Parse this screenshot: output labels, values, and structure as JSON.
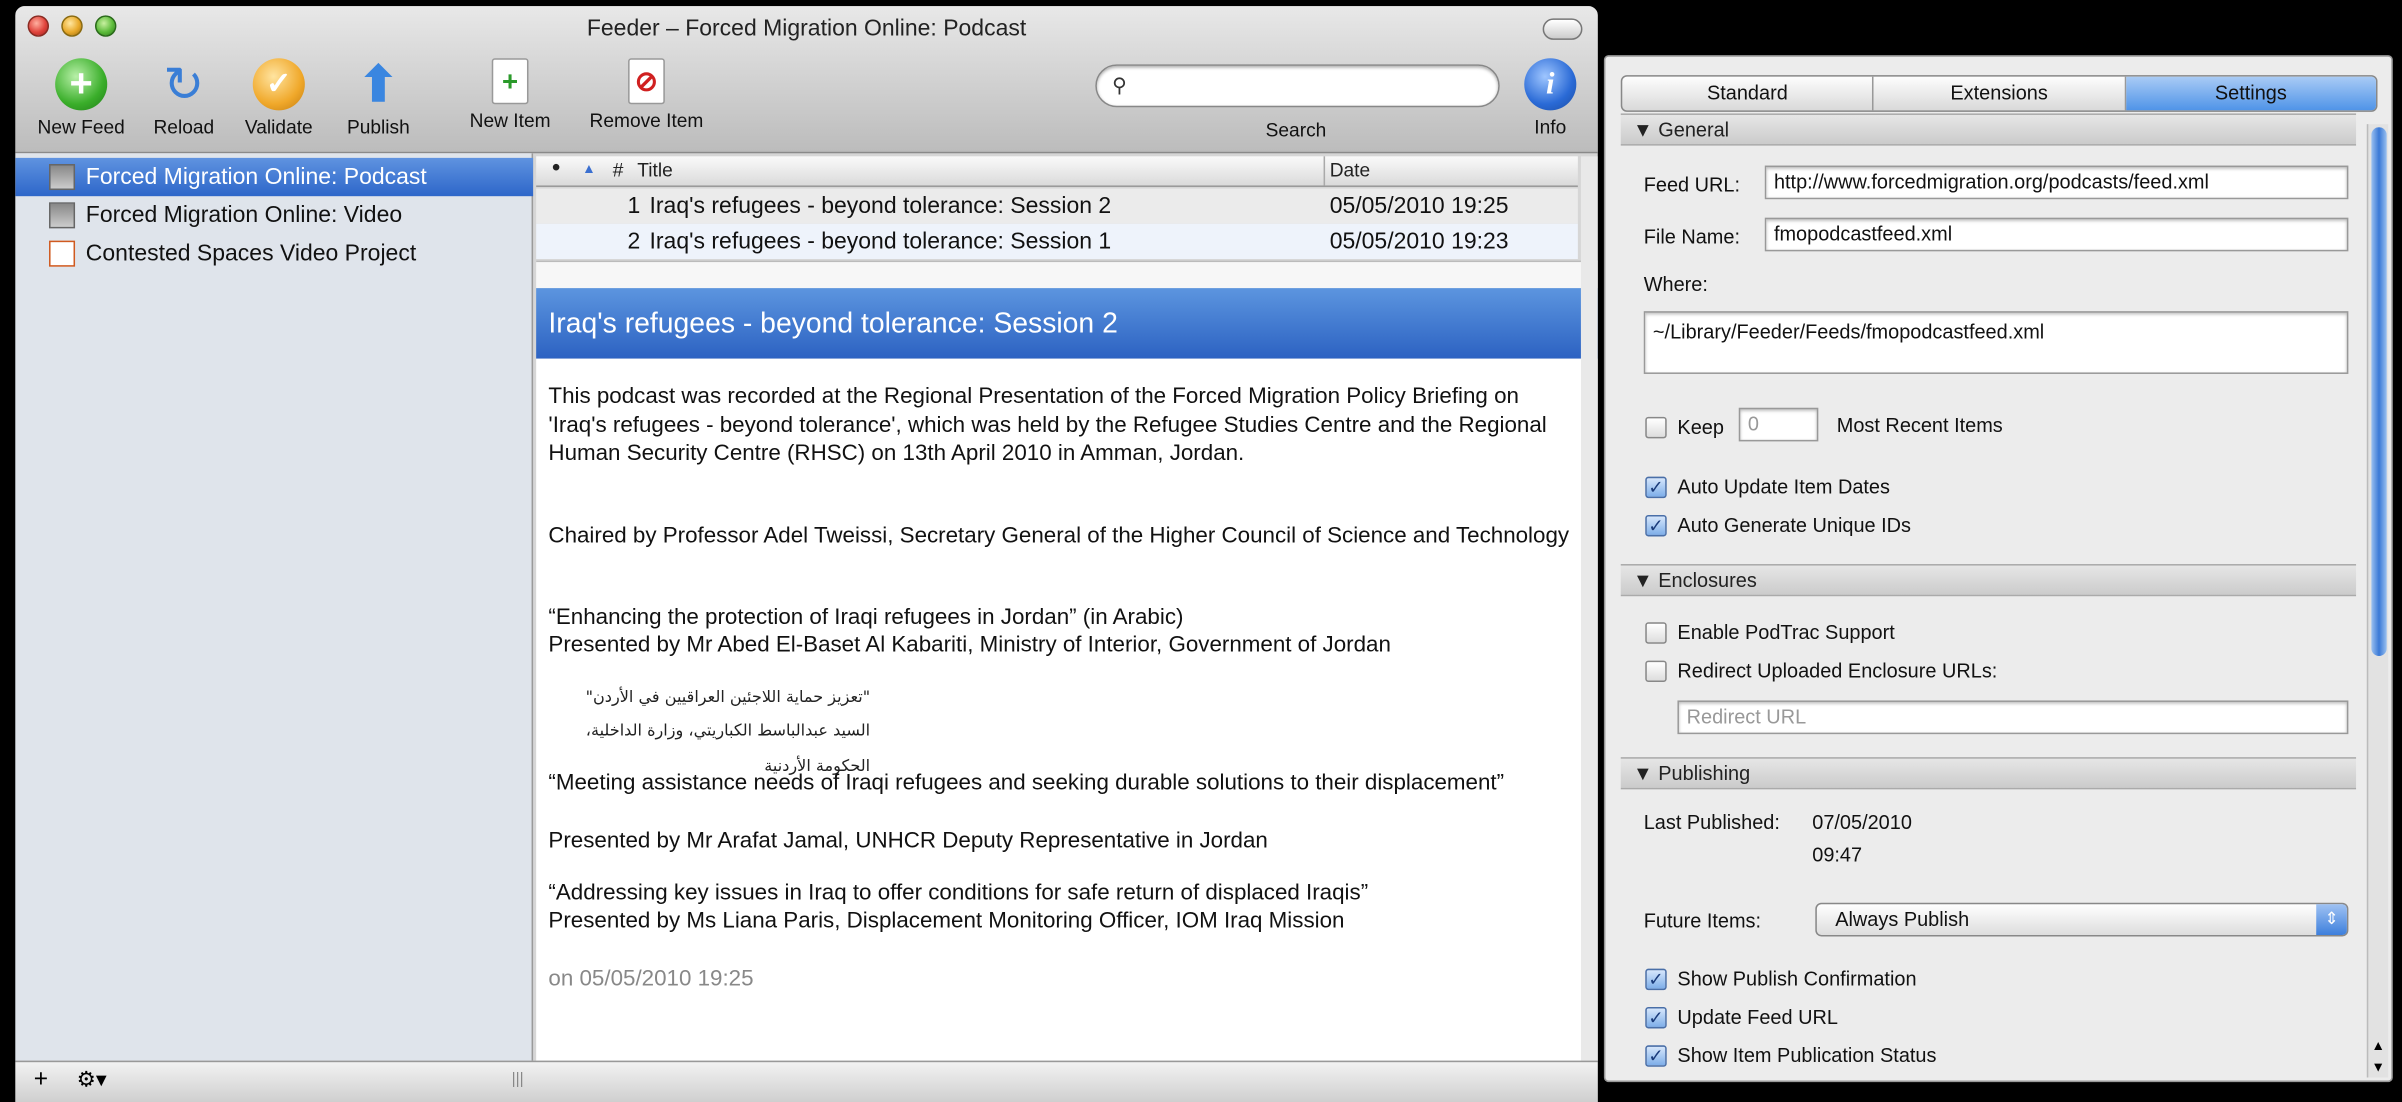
{
  "window": {
    "title": "Feeder – Forced Migration Online: Podcast",
    "toolbar": {
      "new_feed": "New Feed",
      "reload": "Reload",
      "validate": "Validate",
      "publish": "Publish",
      "new_item": "New Item",
      "remove_item": "Remove Item",
      "search": "Search",
      "info": "Info"
    }
  },
  "sidebar": {
    "items": [
      {
        "label": "Forced Migration Online: Podcast",
        "selected": true
      },
      {
        "label": "Forced Migration Online: Video",
        "selected": false
      },
      {
        "label": "Contested Spaces Video Project",
        "selected": false
      }
    ],
    "add": "+",
    "action": "⚙▾"
  },
  "items_table": {
    "columns": {
      "num": "#",
      "title": "Title",
      "date": "Date"
    },
    "rows": [
      {
        "num": "1",
        "title": "Iraq's refugees - beyond tolerance: Session 2",
        "date": "05/05/2010 19:25"
      },
      {
        "num": "2",
        "title": "Iraq's refugees - beyond tolerance: Session 1",
        "date": "05/05/2010 19:23"
      }
    ]
  },
  "detail": {
    "heading": "Iraq's refugees - beyond tolerance: Session 2",
    "p1": "This podcast was recorded at the Regional Presentation of the Forced Migration Policy Briefing on 'Iraq's refugees - beyond tolerance', which was held by the Refugee Studies Centre and the Regional Human Security Centre (RHSC) on 13th April 2010 in Amman, Jordan.",
    "p2": "Chaired by Professor Adel Tweissi, Secretary General of the Higher Council of Science and Technology",
    "p3": "“Enhancing the protection of Iraqi refugees in Jordan” (in Arabic)",
    "p3b": "Presented by Mr Abed El-Baset Al Kabariti, Ministry of Interior, Government of Jordan",
    "ar1": "\"تعزيز حماية اللاجئين العراقيين في الأردن\"",
    "ar2": "السيد عبدالباسط الكباريتي، وزارة الداخلية، الحكومة الأردنية",
    "p4": "“Meeting assistance needs of Iraqi refugees and seeking durable solutions to their displacement”",
    "p4b": "Presented by Mr Arafat Jamal, UNHCR Deputy Representative in Jordan",
    "p5": "“Addressing key issues in Iraq to offer conditions for safe return of displaced Iraqis”",
    "p5b": "Presented by Ms Liana Paris, Displacement Monitoring Officer, IOM Iraq Mission",
    "footer": "on 05/05/2010 19:25"
  },
  "panel": {
    "tabs": [
      "Standard",
      "Extensions",
      "Settings"
    ],
    "general": {
      "header": "General",
      "feed_url_label": "Feed URL:",
      "feed_url": "http://www.forcedmigration.org/podcasts/feed.xml",
      "file_name_label": "File Name:",
      "file_name": "fmopodcastfeed.xml",
      "where_label": "Where:",
      "where": "~/Library/Feeder/Feeds/fmopodcastfeed.xml",
      "keep_label": "Keep",
      "keep_value": "0",
      "most_recent": "Most Recent Items",
      "auto_update": "Auto Update Item Dates",
      "auto_generate": "Auto Generate Unique IDs"
    },
    "enclosures": {
      "header": "Enclosures",
      "podtrac": "Enable PodTrac Support",
      "redirect": "Redirect Uploaded Enclosure URLs:",
      "redirect_placeholder": "Redirect URL"
    },
    "publishing": {
      "header": "Publishing",
      "last_published_label": "Last Published:",
      "last_published_date": "07/05/2010",
      "last_published_time": "09:47",
      "future_items_label": "Future Items:",
      "future_items_value": "Always Publish",
      "show_confirmation": "Show Publish Confirmation",
      "update_feed_url": "Update Feed URL",
      "show_status": "Show Item Publication Status"
    }
  },
  "colors": {
    "selection": "#2d66c9",
    "accent": "#4f94e8"
  }
}
